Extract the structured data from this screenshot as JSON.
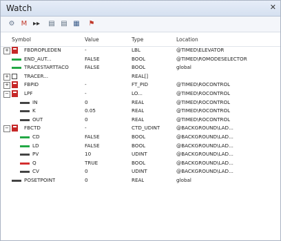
{
  "window": {
    "title": "Watch",
    "pin_icon": "pin-icon"
  },
  "toolbar": {
    "icons": [
      "watch-icon",
      "toggle-icon",
      "step-icon",
      "copy-icon",
      "paste-icon",
      "delete-icon",
      "flag-icon"
    ],
    "glyphs": [
      "⚙",
      "M",
      "▸▸",
      "▤",
      "▤",
      "▦",
      "⚑"
    ]
  },
  "columns": {
    "symbol": "Symbol",
    "value": "Value",
    "type": "Type",
    "location": "Location"
  },
  "colors": {
    "green": "#22a845",
    "red": "#d32f2f",
    "dark": "#444444",
    "fb_red": "#c62828"
  },
  "rows": [
    {
      "indent": 0,
      "expander": "+",
      "icon": "fb",
      "symbol": "FBDROPLEDEN",
      "value": "-",
      "type": "LBL",
      "location": "@TIMED\\ELEVATOR"
    },
    {
      "indent": 0,
      "expander": "",
      "icon": "green",
      "symbol": "END_AUT...",
      "value": "FALSE",
      "type": "BOOL",
      "location": "@TIMED\\ROMODESELECTOR"
    },
    {
      "indent": 0,
      "expander": "",
      "icon": "green",
      "symbol": "TRACESTARTTACO",
      "value": "FALSE",
      "type": "BOOL",
      "location": "global"
    },
    {
      "indent": 0,
      "expander": "+",
      "icon": "box",
      "symbol": "TRACER...",
      "value": "",
      "type": "REAL[]",
      "location": ""
    },
    {
      "indent": 0,
      "expander": "+",
      "icon": "fb",
      "symbol": "FBPID",
      "value": "-",
      "type": "FT_PID",
      "location": "@TIMED\\ROCONTROL"
    },
    {
      "indent": 0,
      "expander": "-",
      "icon": "fb",
      "symbol": "LPF",
      "value": "-",
      "type": "LO...",
      "location": "@TIMED\\ROCONTROL"
    },
    {
      "indent": 1,
      "expander": "",
      "icon": "dark",
      "symbol": "IN",
      "value": "0",
      "type": "REAL",
      "location": "@TIMED\\ROCONTROL"
    },
    {
      "indent": 1,
      "expander": "",
      "icon": "dark",
      "symbol": "K",
      "value": "0.05",
      "type": "REAL",
      "location": "@TIMED\\ROCONTROL"
    },
    {
      "indent": 1,
      "expander": "",
      "icon": "dark",
      "symbol": "OUT",
      "value": "0",
      "type": "REAL",
      "location": "@TIMED\\ROCONTROL"
    },
    {
      "indent": 0,
      "expander": "-",
      "icon": "fb",
      "symbol": "FBCTD",
      "value": "-",
      "type": "CTD_UDINT",
      "location": "@BACKGROUND\\LAD..."
    },
    {
      "indent": 1,
      "expander": "",
      "icon": "green",
      "symbol": "CD",
      "value": "FALSE",
      "type": "BOOL",
      "location": "@BACKGROUND\\LAD..."
    },
    {
      "indent": 1,
      "expander": "",
      "icon": "green",
      "symbol": "LD",
      "value": "FALSE",
      "type": "BOOL",
      "location": "@BACKGROUND\\LAD..."
    },
    {
      "indent": 1,
      "expander": "",
      "icon": "dark",
      "symbol": "PV",
      "value": "10",
      "type": "UDINT",
      "location": "@BACKGROUND\\LAD..."
    },
    {
      "indent": 1,
      "expander": "",
      "icon": "red",
      "symbol": "Q",
      "value": "TRUE",
      "type": "BOOL",
      "location": "@BACKGROUND\\LAD..."
    },
    {
      "indent": 1,
      "expander": "",
      "icon": "dark",
      "symbol": "CV",
      "value": "0",
      "type": "UDINT",
      "location": "@BACKGROUND\\LAD..."
    },
    {
      "indent": 0,
      "expander": "",
      "icon": "dark",
      "symbol": "POSETPOINT",
      "value": "0",
      "type": "REAL",
      "location": "global"
    }
  ]
}
